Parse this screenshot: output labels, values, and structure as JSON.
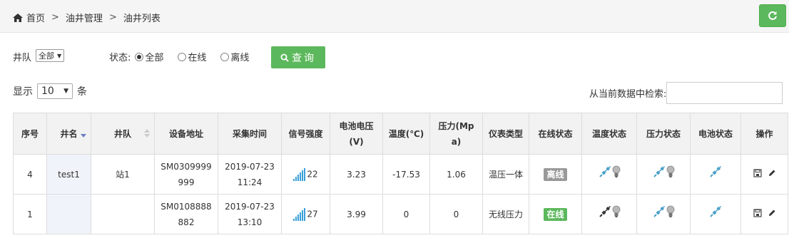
{
  "breadcrumb": {
    "home": "首页",
    "sep1": ">",
    "level2": "油井管理",
    "sep2": ">",
    "level3": "油井列表"
  },
  "filters": {
    "team_label": "井队",
    "team_selected": "全部",
    "status_label": "状态:",
    "status_options": [
      "全部",
      "在线",
      "离线"
    ],
    "status_selected_index": 0,
    "query_label": "查询"
  },
  "length": {
    "prefix": "显示",
    "value": "10",
    "suffix": "条"
  },
  "search": {
    "label": "从当前数据中检索:",
    "value": ""
  },
  "table": {
    "headers": [
      "序号",
      "井名",
      "井队",
      "设备地址",
      "采集时间",
      "信号强度",
      "电池电压(V)",
      "温度(℃)",
      "压力(Mpa)",
      "仪表类型",
      "在线状态",
      "温度状态",
      "压力状态",
      "电池状态",
      "操作"
    ],
    "rows": [
      {
        "index": "4",
        "name": "test1",
        "team": "站1",
        "address": "SM0309999999",
        "time": "2019-07-23 11:24",
        "signal": "22",
        "voltage": "3.23",
        "temperature": "-17.53",
        "pressure": "1.06",
        "meter": "温压一体",
        "online": "离线",
        "online_color": "#999999",
        "temp_plug_color": "#4aa0c8",
        "pressure_plug_color": "#4aa0c8",
        "battery_plug_color": "#4aa0c8"
      },
      {
        "index": "1",
        "name": "",
        "team": "",
        "address": "SM0108888882",
        "time": "2019-07-23 13:10",
        "signal": "27",
        "voltage": "3.99",
        "temperature": "0",
        "pressure": "0",
        "meter": "无线压力",
        "online": "在线",
        "online_color": "#5cb85c",
        "temp_plug_color": "#333333",
        "pressure_plug_color": "#4aa0c8",
        "battery_plug_color": "#4aa0c8"
      }
    ]
  },
  "colors": {
    "accent": "#5cb85c",
    "signal": "#3aa0d8"
  }
}
